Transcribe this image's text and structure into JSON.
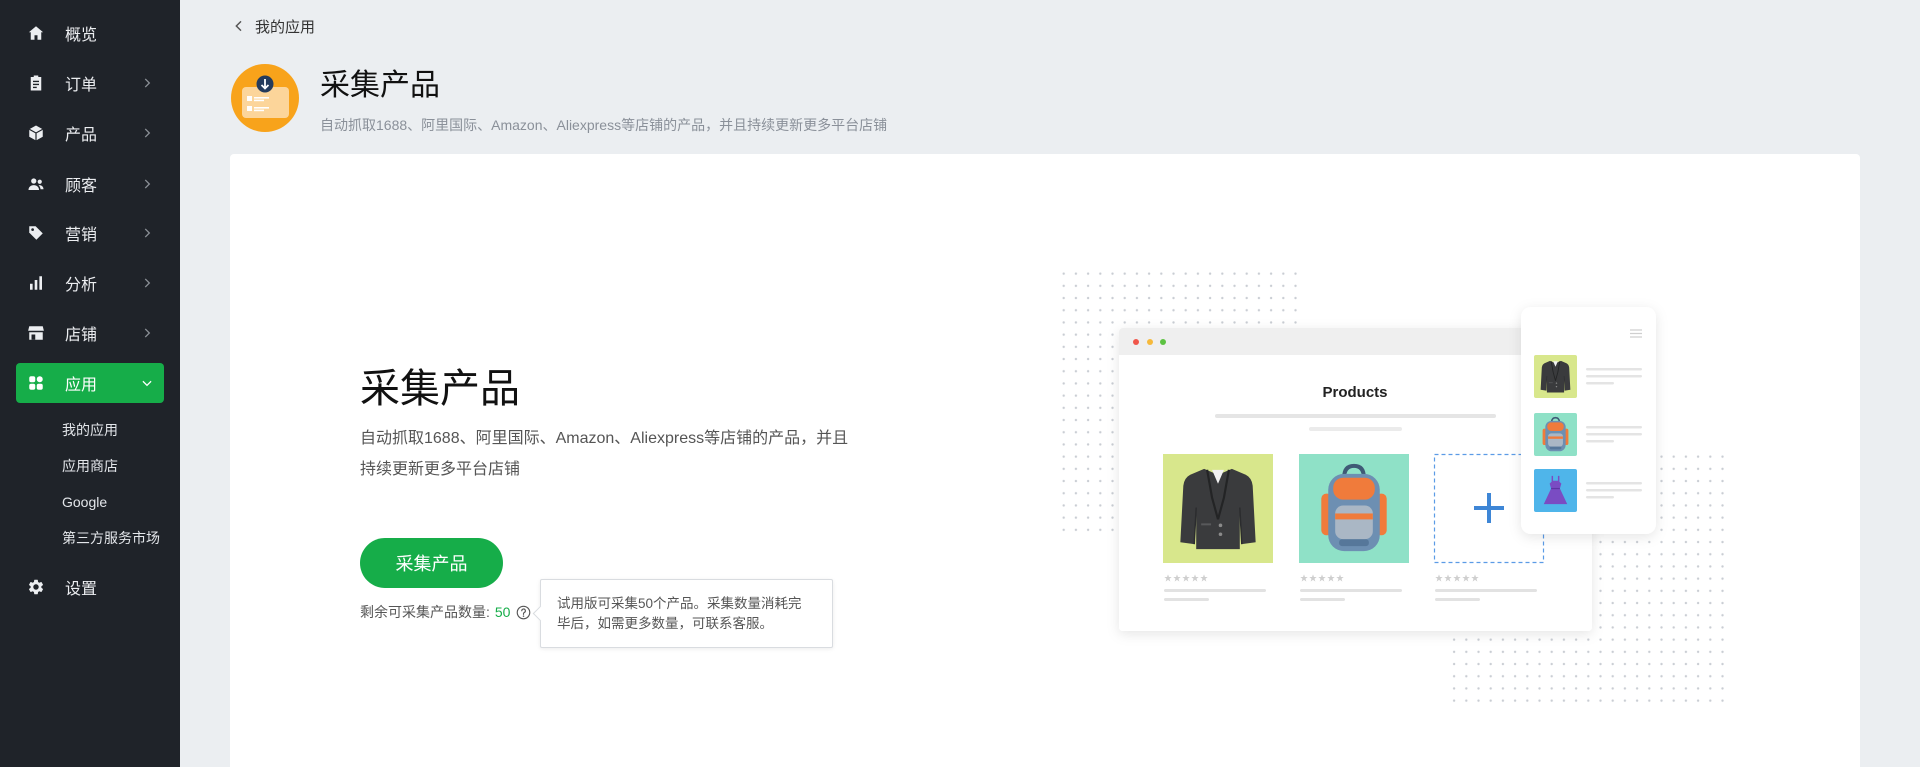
{
  "theme": {
    "accent": "#16ad49",
    "sidebar_bg": "#1f2329",
    "page_bg": "#ebeef1",
    "app_icon_bg": "#f8a31b",
    "plus_blue": "#3e86d6"
  },
  "sidebar": {
    "items": [
      {
        "label": "概览",
        "icon": "home-icon"
      },
      {
        "label": "订单",
        "icon": "clipboard-icon",
        "chevron": "chevron-right-icon"
      },
      {
        "label": "产品",
        "icon": "cube-icon",
        "chevron": "chevron-right-icon"
      },
      {
        "label": "顾客",
        "icon": "users-icon",
        "chevron": "chevron-right-icon"
      },
      {
        "label": "营销",
        "icon": "tag-icon",
        "chevron": "chevron-right-icon"
      },
      {
        "label": "分析",
        "icon": "bar-chart-icon",
        "chevron": "chevron-right-icon"
      },
      {
        "label": "店铺",
        "icon": "store-icon",
        "chevron": "chevron-right-icon"
      },
      {
        "label": "应用",
        "icon": "apps-grid-icon",
        "chevron": "chevron-down-icon",
        "active": true
      }
    ],
    "sub_items": [
      {
        "label": "我的应用"
      },
      {
        "label": "应用商店"
      },
      {
        "label": "Google"
      },
      {
        "label": "第三方服务市场"
      }
    ],
    "settings": {
      "label": "设置",
      "icon": "gear-icon"
    }
  },
  "header": {
    "back_label": "我的应用",
    "app_title": "采集产品",
    "app_subtitle": "自动抓取1688、阿里国际、Amazon、Aliexpress等店铺的产品，并且持续更新更多平台店铺"
  },
  "card": {
    "title": "采集产品",
    "description": "自动抓取1688、阿里国际、Amazon、Aliexpress等店铺的产品，并且持续更新更多平台店铺",
    "button_label": "采集产品",
    "remaining_label": "剩余可采集产品数量:",
    "remaining_count": "50",
    "tooltip": "试用版可采集50个产品。采集数量消耗完毕后，如需更多数量，可联系客服。"
  },
  "illustration": {
    "heading": "Products"
  }
}
